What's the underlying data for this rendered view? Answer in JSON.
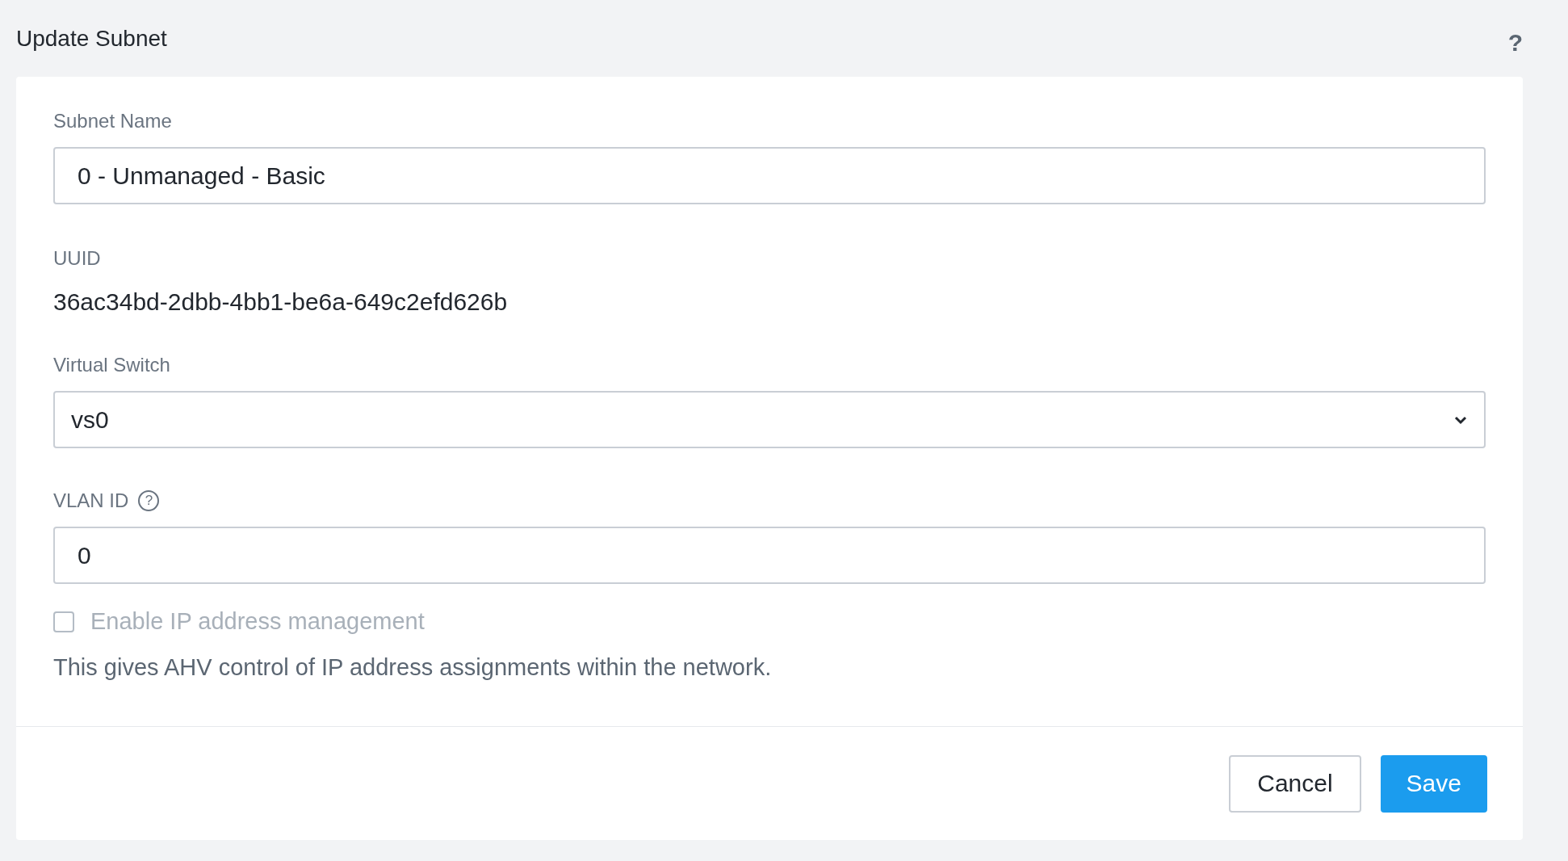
{
  "header": {
    "title": "Update Subnet",
    "help": "?"
  },
  "form": {
    "subnet_name": {
      "label": "Subnet Name",
      "value": "0 - Unmanaged - Basic"
    },
    "uuid": {
      "label": "UUID",
      "value": "36ac34bd-2dbb-4bb1-be6a-649c2efd626b"
    },
    "virtual_switch": {
      "label": "Virtual Switch",
      "value": "vs0"
    },
    "vlan_id": {
      "label": "VLAN ID",
      "help": "?",
      "value": "0"
    },
    "ip_management": {
      "label": "Enable IP address management",
      "checked": false,
      "disabled": true,
      "description": "This gives AHV control of IP address assignments within the network."
    }
  },
  "buttons": [
    {
      "label": "Cancel",
      "kind": "secondary"
    },
    {
      "label": "Save",
      "kind": "primary"
    }
  ]
}
